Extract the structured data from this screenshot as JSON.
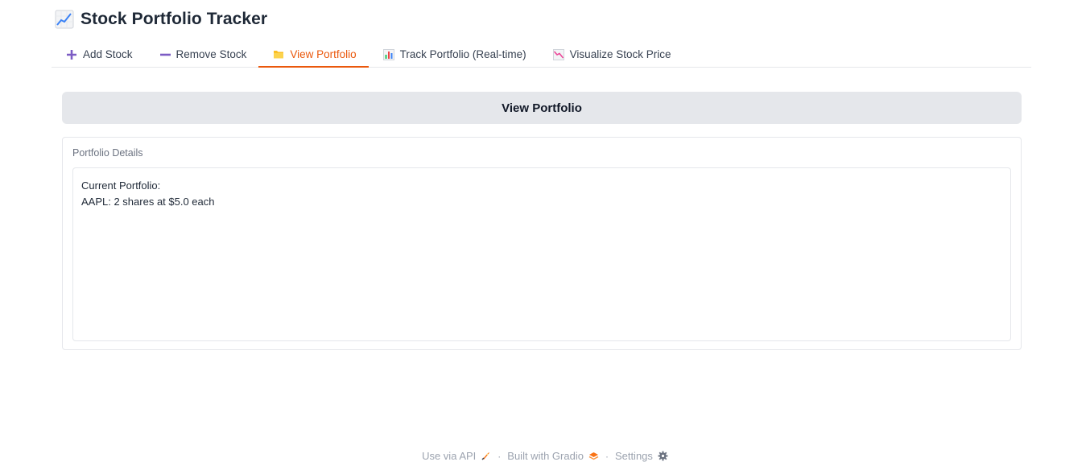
{
  "app": {
    "title": "Stock Portfolio Tracker",
    "logo_icon": "chart-increasing-icon"
  },
  "tabs": [
    {
      "label": "Add Stock",
      "icon": "plus-icon",
      "active": false
    },
    {
      "label": "Remove Stock",
      "icon": "minus-icon",
      "active": false
    },
    {
      "label": "View Portfolio",
      "icon": "folder-icon",
      "active": true
    },
    {
      "label": "Track Portfolio (Real-time)",
      "icon": "bar-chart-icon",
      "active": false
    },
    {
      "label": "Visualize Stock Price",
      "icon": "chart-decreasing-icon",
      "active": false
    }
  ],
  "main": {
    "view_button_label": "View Portfolio",
    "output": {
      "label": "Portfolio Details",
      "value": "Current Portfolio:\nAAPL: 2 shares at $5.0 each"
    }
  },
  "footer": {
    "api_label": "Use via API",
    "built_label": "Built with Gradio",
    "settings_label": "Settings",
    "separator": "·"
  },
  "colors": {
    "accent": "#ea580c",
    "button_bg": "#e5e7eb",
    "border": "#e5e7eb"
  }
}
